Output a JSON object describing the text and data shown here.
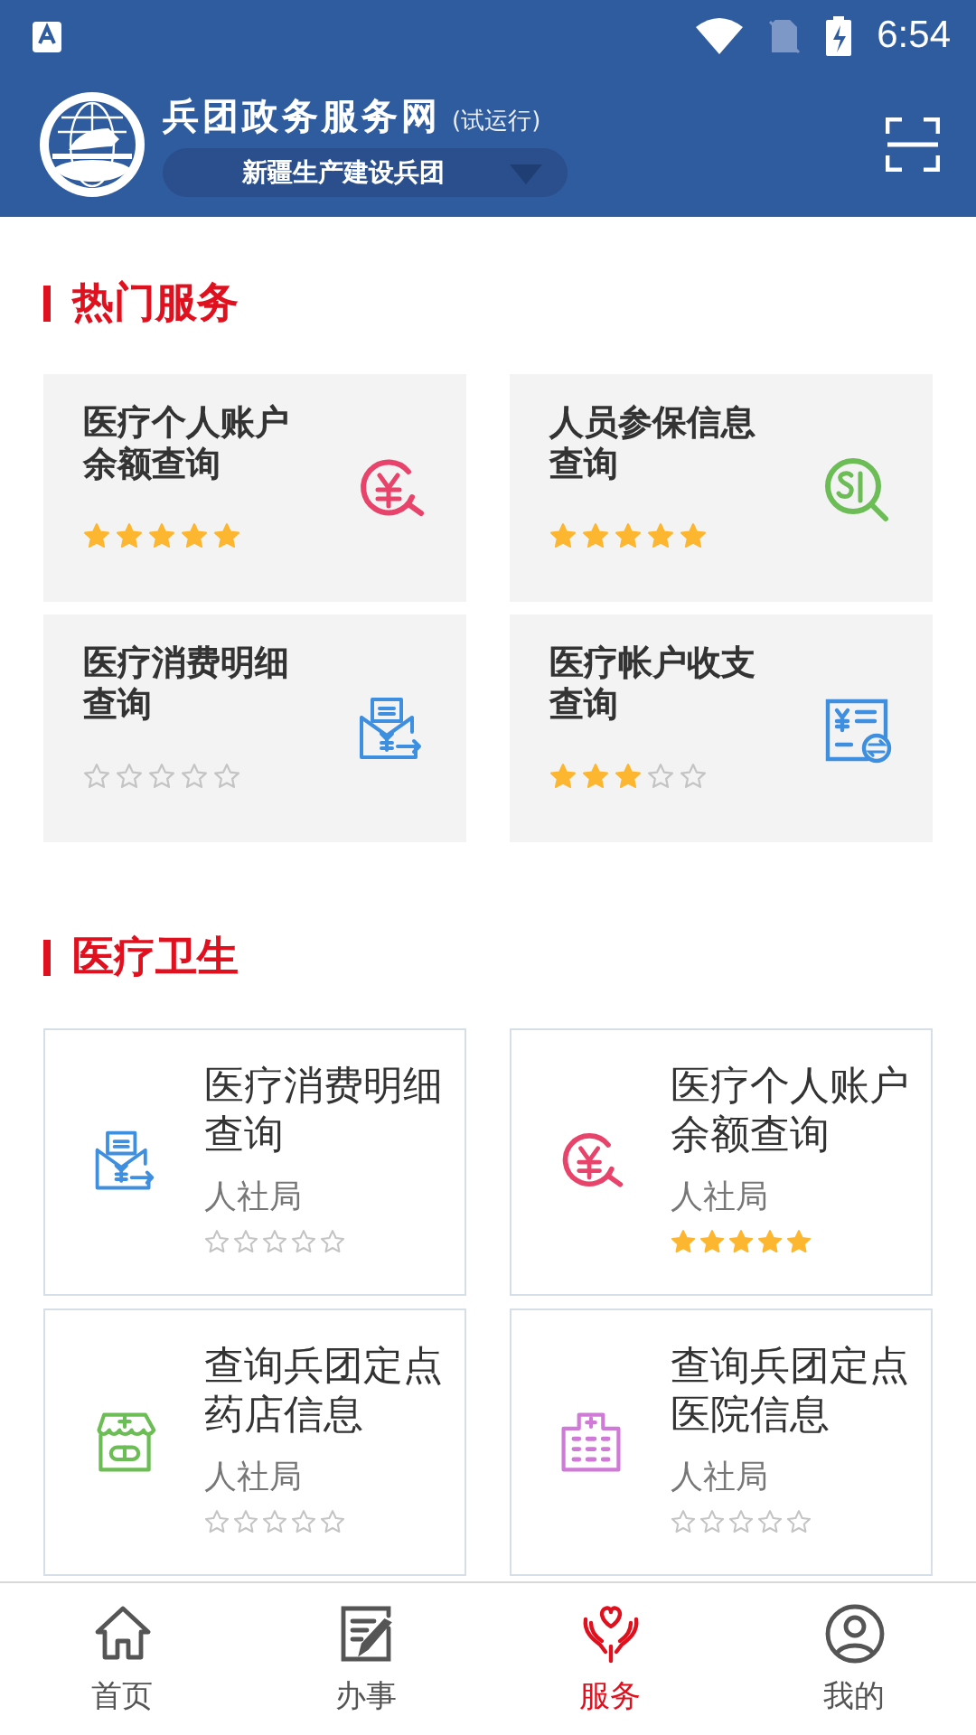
{
  "status_bar": {
    "time": "6:54"
  },
  "header": {
    "title": "兵团政务服务网",
    "subtitle": "(试运行)",
    "region": "新疆生产建设兵团"
  },
  "hot_services": {
    "title": "热门服务",
    "items": [
      {
        "title": "医疗个人账户余额查询",
        "kind": "yuan-search",
        "stars": 5
      },
      {
        "title": "人员参保信息查询",
        "kind": "si-search",
        "stars": 5
      },
      {
        "title": "医疗消费明细查询",
        "kind": "envelope-yuan",
        "stars": 0
      },
      {
        "title": "医疗帐户收支查询",
        "kind": "ledger",
        "stars": 3
      }
    ]
  },
  "medical": {
    "title": "医疗卫生",
    "items": [
      {
        "title": "医疗消费明细查询",
        "dept": "人社局",
        "kind": "envelope-yuan",
        "stars": 0
      },
      {
        "title": "医疗个人账户余额查询",
        "dept": "人社局",
        "kind": "yuan-search",
        "stars": 5
      },
      {
        "title": "查询兵团定点药店信息",
        "dept": "人社局",
        "kind": "pharmacy",
        "stars": 0
      },
      {
        "title": "查询兵团定点医院信息",
        "dept": "人社局",
        "kind": "hospital",
        "stars": 0
      }
    ]
  },
  "tabs": [
    {
      "label": "首页",
      "kind": "home",
      "selected": false
    },
    {
      "label": "办事",
      "kind": "edit",
      "selected": false
    },
    {
      "label": "服务",
      "kind": "service",
      "selected": true
    },
    {
      "label": "我的",
      "kind": "user",
      "selected": false
    }
  ]
}
